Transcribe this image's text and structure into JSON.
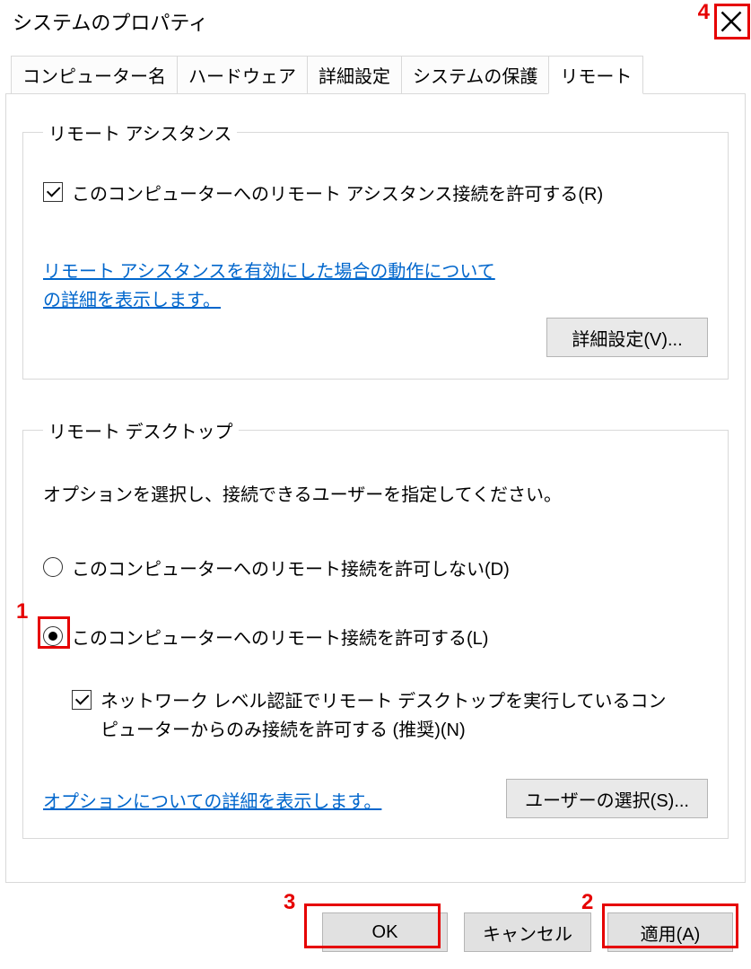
{
  "title": "システムのプロパティ",
  "tabs": [
    {
      "label": "コンピューター名"
    },
    {
      "label": "ハードウェア"
    },
    {
      "label": "詳細設定"
    },
    {
      "label": "システムの保護"
    },
    {
      "label": "リモート",
      "active": true
    }
  ],
  "remote_assistance": {
    "legend": "リモート アシスタンス",
    "allow_checkbox_label": "このコンピューターへのリモート アシスタンス接続を許可する(R)",
    "info_link": "リモート アシスタンスを有効にした場合の動作についての詳細を表示します。",
    "advanced_button": "詳細設定(V)..."
  },
  "remote_desktop": {
    "legend": "リモート デスクトップ",
    "instruction": "オプションを選択し、接続できるユーザーを指定してください。",
    "radio_disallow": "このコンピューターへのリモート接続を許可しない(D)",
    "radio_allow": "このコンピューターへのリモート接続を許可する(L)",
    "nla_checkbox_label": "ネットワーク レベル認証でリモート デスクトップを実行しているコンピューターからのみ接続を許可する (推奨)(N)",
    "options_link": "オプションについての詳細を表示します。",
    "select_users_button": "ユーザーの選択(S)..."
  },
  "footer": {
    "ok": "OK",
    "cancel": "キャンセル",
    "apply": "適用(A)"
  },
  "annotations": {
    "m1": "1",
    "m2": "2",
    "m3": "3",
    "m4": "4"
  }
}
